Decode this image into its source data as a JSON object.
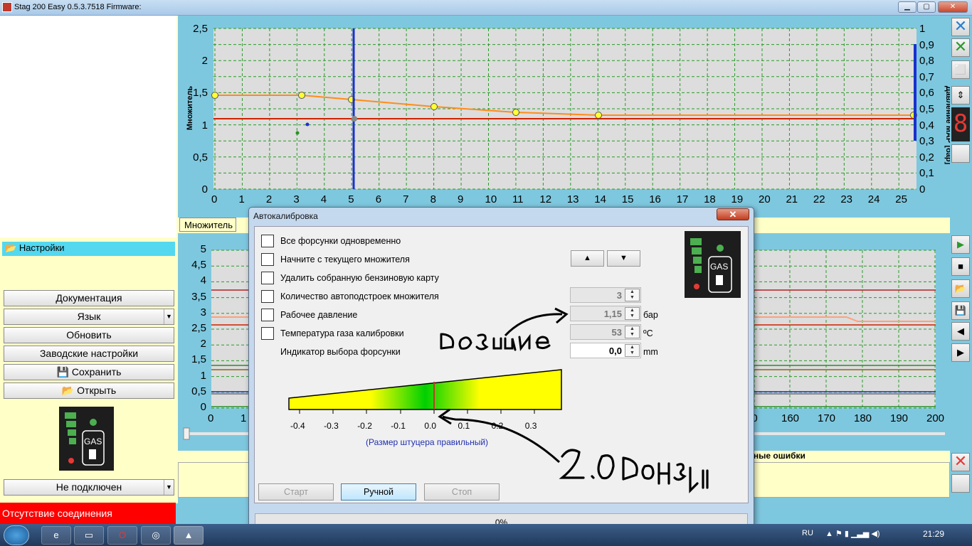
{
  "window": {
    "title": "Stag 200 Easy 0.5.3.7518 Firmware:",
    "min": "▁",
    "max": "▢",
    "close": "✕"
  },
  "left_panel": {
    "settings_header": "Настройки",
    "buttons": [
      "Документация",
      "Язык",
      "Обновить",
      "Заводские настройки",
      "Сохранить",
      "Открыть"
    ],
    "connection_select": "Не подключен",
    "status": "Отсутствие соединения",
    "gas_label": "GAS",
    "dropdown_arrow": "▼"
  },
  "top_chart": {
    "ylabel_left": "Множитель",
    "ylabel_right": "Давление МАР [бар]",
    "y_left_ticks": [
      "2,5",
      "2",
      "1,5",
      "1",
      "0,5",
      "0"
    ],
    "y_right_ticks": [
      "1",
      "0,9",
      "0,8",
      "0,7",
      "0,6",
      "0,5",
      "0,4",
      "0,3",
      "0,2",
      "0,1",
      "0"
    ],
    "x_ticks": [
      "0",
      "1",
      "2",
      "3",
      "4",
      "5",
      "6",
      "7",
      "8",
      "9",
      "10",
      "11",
      "12",
      "13",
      "14",
      "15",
      "16",
      "17",
      "18",
      "19",
      "20",
      "21",
      "22",
      "23",
      "24",
      "25"
    ]
  },
  "bottom_chart": {
    "y_ticks": [
      "5",
      "4,5",
      "4",
      "3,5",
      "3",
      "2,5",
      "2",
      "1,5",
      "1",
      "0,5",
      "0"
    ],
    "x_ticks_left": [
      "0",
      "1"
    ],
    "x_ticks_right": [
      "60",
      "160",
      "170",
      "180",
      "190",
      "200"
    ]
  },
  "tab_label": "Множитель",
  "errors_header": "анные ошибки",
  "dialog": {
    "title": "Автокалибровка",
    "close": "✕",
    "options": [
      "Все форсунки одновременно",
      "Начните с текущего множителя",
      "Удалить собранную бензиновую карту",
      "Количество автоподстроек множителя",
      "Рабочее давление",
      "Температура газа калибровки"
    ],
    "indicator_label": "Индикатор выбора форсунки",
    "fields": {
      "autotune_count": "3",
      "pressure": "1,15",
      "temperature": "53",
      "indicator": "0,0"
    },
    "units": {
      "pressure": "бар",
      "temperature": "ºC",
      "indicator": "mm"
    },
    "gauge_ticks": [
      "-0.4",
      "-0.3",
      "-0.2",
      "-0.1",
      "0.0",
      "0.1",
      "0.2",
      "0.3"
    ],
    "gauge_status": "(Размер штуцера правильный)",
    "buttons": {
      "start": "Старт",
      "manual": "Ручной",
      "stop": "Стоп"
    },
    "progress": "0%",
    "gas_label": "GAS",
    "spin_arrows": "▲\n▼",
    "up": "▲",
    "down": "▼"
  },
  "taskbar": {
    "lang": "RU",
    "time": "21:29"
  }
}
